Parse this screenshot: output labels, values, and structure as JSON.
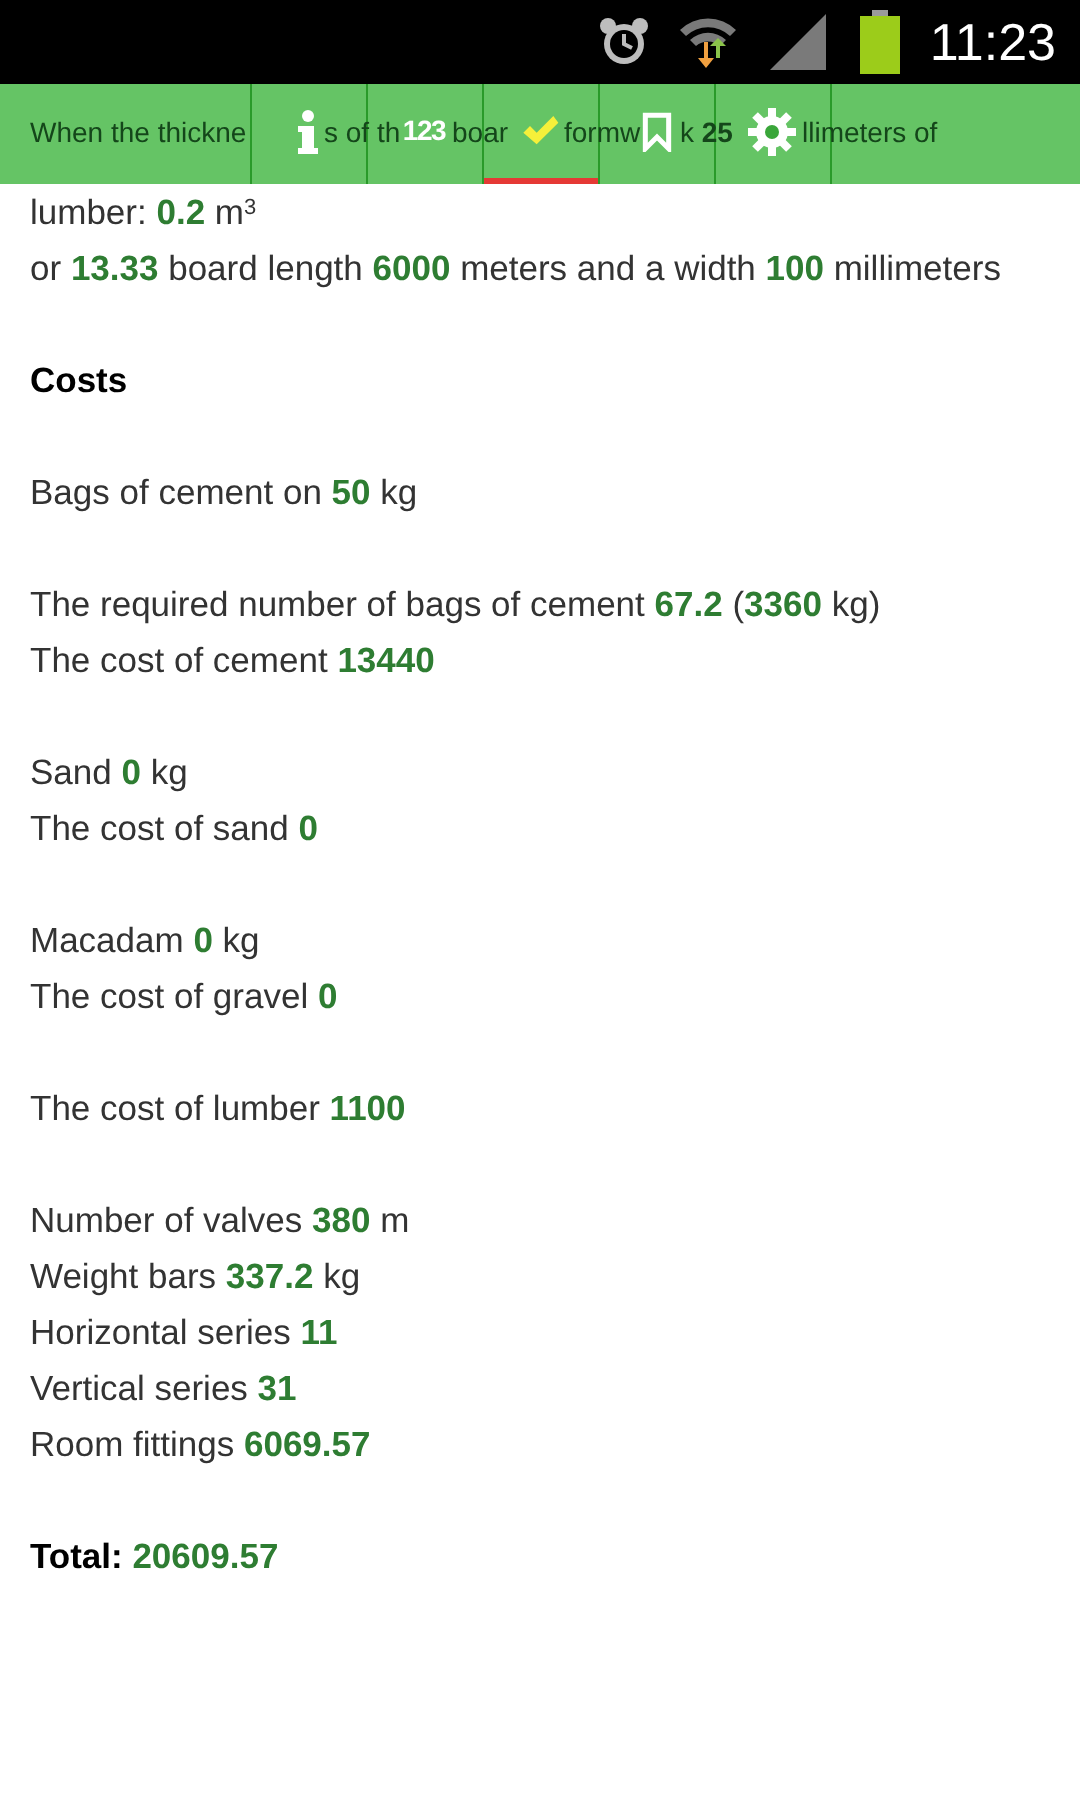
{
  "status_bar": {
    "time": "11:23"
  },
  "tabs": [
    {
      "kind": "info",
      "selected": false
    },
    {
      "kind": "numbers",
      "label": "123",
      "selected": false
    },
    {
      "kind": "check",
      "selected": true
    },
    {
      "kind": "bookmark",
      "selected": false
    },
    {
      "kind": "settings",
      "selected": false
    }
  ],
  "groups": [
    {
      "lines": [
        {
          "kind": "fragments",
          "parts": [
            "When the thickne",
            "s of th",
            "boar",
            "formw",
            "k **25**",
            "llimeters of"
          ]
        },
        {
          "kind": "text",
          "text": "lumber: **0.2** m$^{3}$"
        },
        {
          "kind": "text",
          "text": "or **13.33** board length **6000** meters and a width **100** millimeters"
        }
      ]
    },
    {
      "lines": [
        {
          "kind": "heading",
          "text": "Costs"
        }
      ]
    },
    {
      "lines": [
        {
          "kind": "text",
          "text": "Bags of cement on **50** kg"
        }
      ]
    },
    {
      "lines": [
        {
          "kind": "text",
          "text": "The required number of bags of cement **67.2** (**3360** kg)"
        },
        {
          "kind": "text",
          "text": "The cost of cement **13440**"
        }
      ]
    },
    {
      "lines": [
        {
          "kind": "text",
          "text": "Sand **0** kg"
        },
        {
          "kind": "text",
          "text": "The cost of sand **0**"
        }
      ]
    },
    {
      "lines": [
        {
          "kind": "text",
          "text": "Macadam **0** kg"
        },
        {
          "kind": "text",
          "text": "The cost of gravel **0**"
        }
      ]
    },
    {
      "lines": [
        {
          "kind": "text",
          "text": "The cost of lumber **1100**"
        }
      ]
    },
    {
      "lines": [
        {
          "kind": "text",
          "text": "Number of valves **380** m"
        },
        {
          "kind": "text",
          "text": "Weight bars **337.2** kg"
        },
        {
          "kind": "text",
          "text": "Horizontal series **11**"
        },
        {
          "kind": "text",
          "text": "Vertical series **31**"
        },
        {
          "kind": "text",
          "text": "Room fittings **6069.57**"
        }
      ]
    },
    {
      "lines": [
        {
          "kind": "total",
          "text": "Total: **20609.57**"
        }
      ]
    }
  ]
}
